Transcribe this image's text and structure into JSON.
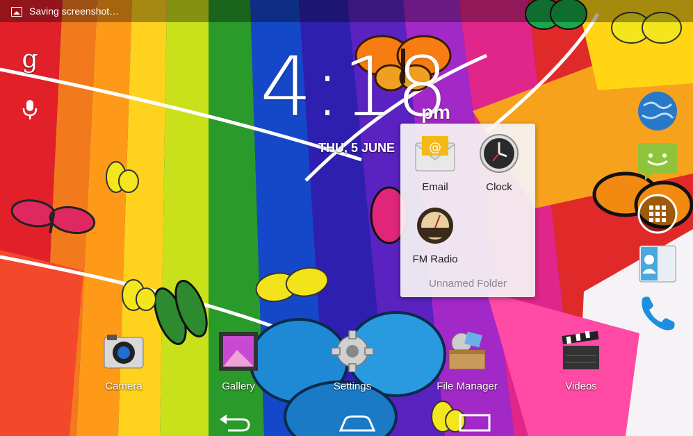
{
  "status_bar": {
    "notification_text": "Saving screenshot…",
    "notification_icon": "image-icon"
  },
  "search": {
    "google_glyph": "g",
    "voice_icon": "microphone-icon"
  },
  "clock_widget": {
    "time": "4:18",
    "ampm": "pm",
    "date": "THU, 5 JUNE"
  },
  "folder": {
    "name": "Unnamed Folder",
    "apps": [
      {
        "label": "Email",
        "icon": "email-icon"
      },
      {
        "label": "Clock",
        "icon": "clock-icon"
      },
      {
        "label": "FM Radio",
        "icon": "radio-icon"
      }
    ]
  },
  "dock": {
    "apps": [
      {
        "label": "Camera",
        "icon": "camera-icon"
      },
      {
        "label": "Gallery",
        "icon": "gallery-icon"
      },
      {
        "label": "Settings",
        "icon": "gear-icon"
      },
      {
        "label": "File Manager",
        "icon": "file-manager-icon"
      },
      {
        "label": "Videos",
        "icon": "clapperboard-icon"
      }
    ]
  },
  "right_column": {
    "apps": [
      {
        "icon": "browser-globe-icon"
      },
      {
        "icon": "messaging-icon"
      },
      {
        "icon": "all-apps-icon"
      },
      {
        "icon": "contacts-icon"
      },
      {
        "icon": "phone-icon"
      }
    ]
  },
  "navigation": {
    "back": "back-icon",
    "home": "home-icon",
    "recents": "recent-apps-icon"
  },
  "colors": {
    "status_bar": "#00000059",
    "folder_bg": "#f5f3f3",
    "accent_orange": "#f08a1c"
  }
}
